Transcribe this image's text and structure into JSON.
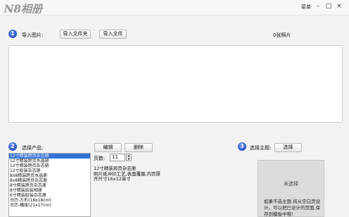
{
  "app": {
    "logo_text": "N8相册",
    "menu_label": "菜单",
    "controls": {
      "minimize": "–",
      "maximize": "□",
      "close": "×"
    }
  },
  "steps": {
    "one": "1",
    "two": "2",
    "three": "3"
  },
  "import": {
    "label": "导入图片:",
    "folder_button": "导入文件夹",
    "file_button": "导入文件",
    "photo_count": "0张照片"
  },
  "product": {
    "label": "选择产品:",
    "items": [
      "12寸精装跨页杂志册",
      "12寸精装跨页水晶册",
      "12寸精装跨页杂志册",
      "12寸胶装杂志册",
      "8x8精装跨页水晶册",
      "8x8精装跨页杂志册",
      "8寸精装跨页杂志册",
      "8寸精装胶装相册",
      "6寸精装胶装杂志册",
      "台历-方形(18x18cm)",
      "台历-横版(21x17cm)"
    ],
    "selected_index": 0,
    "edit_button": "编辑",
    "delete_button": "删除",
    "pages_label": "页数:",
    "pages_value": "11",
    "description_title": "12寸精装跨页杂志册",
    "description_lines": [
      "照片纸冲印工艺,表面覆膜,内页厚",
      "开尺寸16x12英寸"
    ]
  },
  "theme": {
    "label": "选择主题:",
    "select_button": "选择",
    "empty_text": "未选择",
    "hint": "如果不选主题,将从空白页设计。可以把已设计的页面,保存到模板中哦!"
  }
}
